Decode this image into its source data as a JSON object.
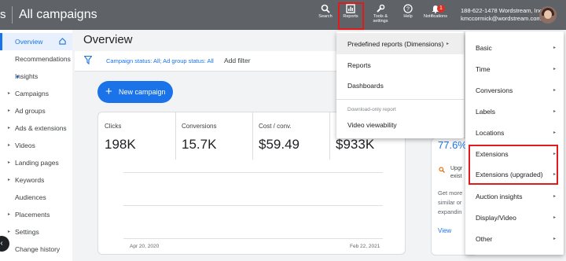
{
  "topbar": {
    "title_fragment": "s",
    "title": "All campaigns",
    "icons": [
      {
        "name": "search-icon",
        "label": "Search"
      },
      {
        "name": "reports-icon",
        "label": "Reports"
      },
      {
        "name": "tools-icon",
        "label1": "Tools &",
        "label2": "settings"
      },
      {
        "name": "help-icon",
        "label": "Help"
      },
      {
        "name": "notifications-icon",
        "label": "Notifications",
        "badge": "1"
      }
    ],
    "account_line1": "188-622-1478 Wordstream, Inc.",
    "account_line2": "kmccormick@wordstream.com"
  },
  "sidebar": {
    "items": [
      {
        "label": "Overview"
      },
      {
        "label": "Recommendations"
      },
      {
        "label": "Insights"
      },
      {
        "label": "Campaigns"
      },
      {
        "label": "Ad groups"
      },
      {
        "label": "Ads & extensions"
      },
      {
        "label": "Videos"
      },
      {
        "label": "Landing pages"
      },
      {
        "label": "Keywords"
      },
      {
        "label": "Audiences"
      },
      {
        "label": "Placements"
      },
      {
        "label": "Settings"
      },
      {
        "label": "Change history"
      }
    ]
  },
  "main": {
    "title": "Overview",
    "filter_status_label": "Campaign status:",
    "filter_status_value": "All",
    "filter_adgroup_label": "Ad group status:",
    "filter_adgroup_value": "All",
    "add_filter": "Add filter",
    "new_campaign": "New campaign",
    "metrics": [
      {
        "label": "Clicks",
        "value": "198K"
      },
      {
        "label": "Conversions",
        "value": "15.7K"
      },
      {
        "label": "Cost / conv.",
        "value": "$59.49"
      },
      {
        "label": "",
        "value": "$933K"
      }
    ],
    "date_start": "Apr 20, 2020",
    "date_end": "Feb 22, 2021"
  },
  "side_card": {
    "big_value": "77.6%",
    "upgrade_line1": "Upgr",
    "upgrade_line2": "exist",
    "more_line1": "Get more",
    "more_line2": "similar or",
    "more_line3": "expandin",
    "view": "View"
  },
  "reports_menu": {
    "items": [
      {
        "label": "Predefined reports (Dimensions)"
      },
      {
        "label": "Reports"
      },
      {
        "label": "Dashboards"
      }
    ],
    "caption": "Download-only report",
    "video_item": "Video viewability"
  },
  "dimensions_menu": {
    "items": [
      {
        "label": "Basic"
      },
      {
        "label": "Time"
      },
      {
        "label": "Conversions"
      },
      {
        "label": "Labels"
      },
      {
        "label": "Locations"
      },
      {
        "label": "Extensions"
      },
      {
        "label": "Extensions (upgraded)"
      },
      {
        "label": "Auction insights"
      },
      {
        "label": "Display/Video"
      },
      {
        "label": "Other"
      }
    ]
  },
  "colors": {
    "accent": "#1a73e8",
    "topbar": "#5f6368",
    "highlight": "#e01b1b"
  }
}
